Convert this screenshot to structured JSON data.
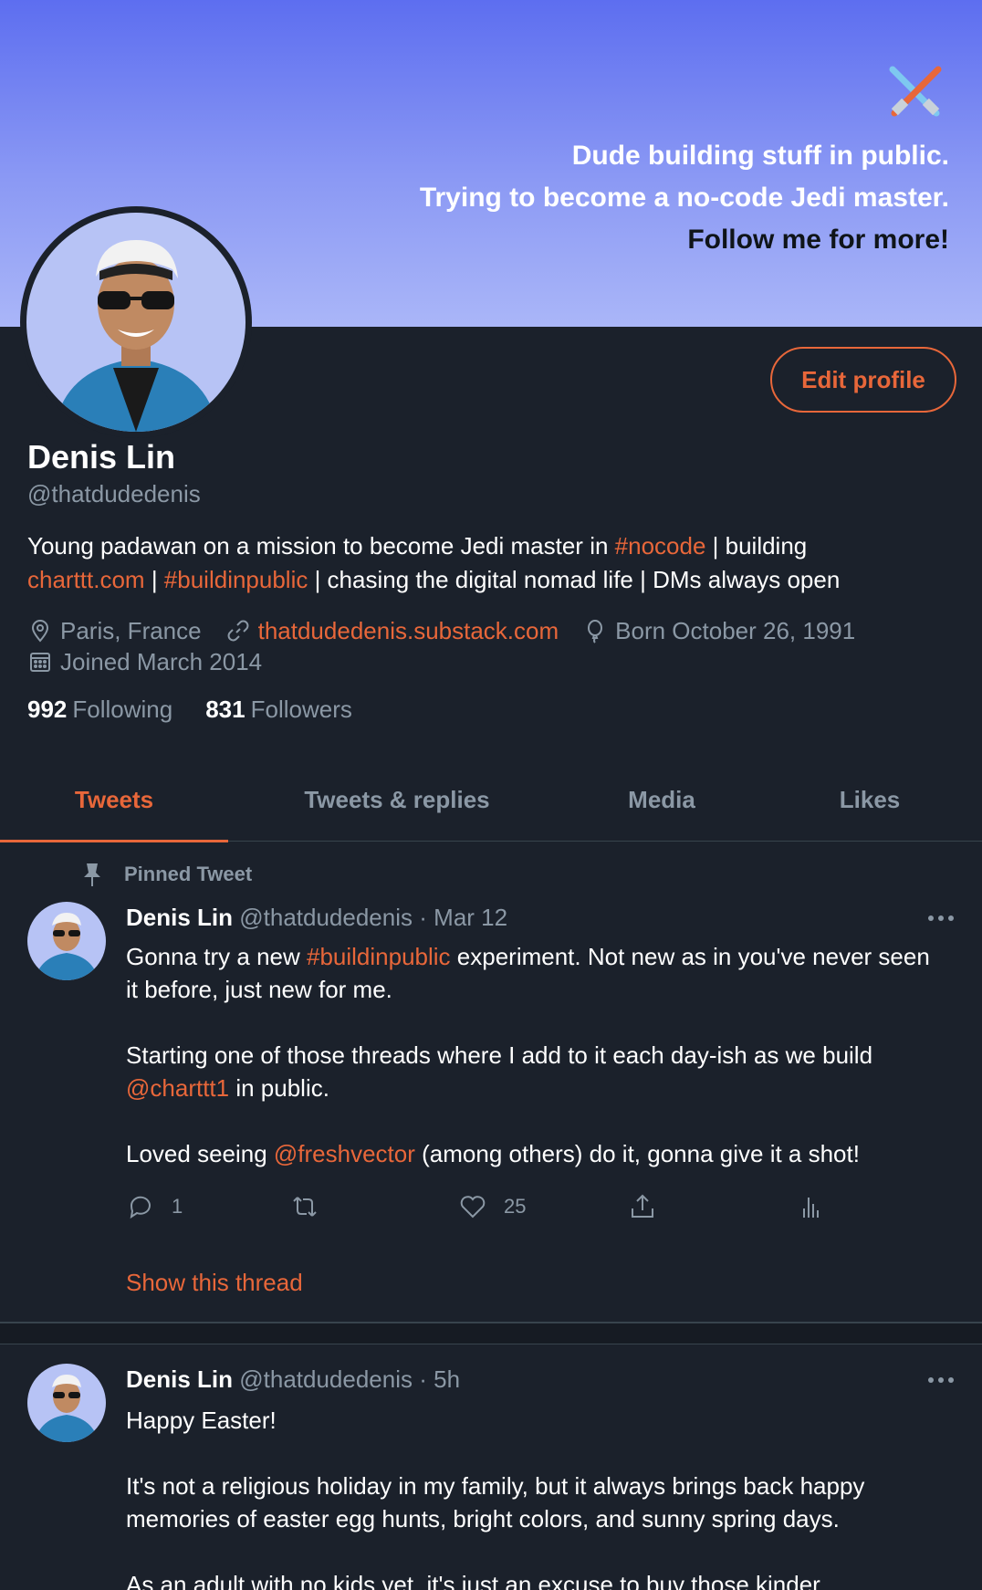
{
  "banner": {
    "line1": "Dude building stuff in public.",
    "line2": "Trying to become a no-code Jedi master.",
    "line3": "Follow me for more!",
    "icon": "crossed-lightsabers-icon"
  },
  "profile": {
    "name": "Denis Lin",
    "handle": "@thatdudedenis",
    "edit_label": "Edit profile",
    "bio": {
      "part1": "Young padawan on a mission to become Jedi master in ",
      "tag_nocode": "#nocode",
      "part2": " | building ",
      "link_charttt": "charttt.com",
      "part3": " | ",
      "tag_buildinpublic": "#buildinpublic",
      "part4": " | chasing the digital nomad life | DMs always open"
    },
    "location": "Paris, France",
    "website": "thatdudedenis.substack.com",
    "birthday": "Born October 26, 1991",
    "joined": "Joined March 2014",
    "following_count": "992",
    "following_label": "Following",
    "followers_count": "831",
    "followers_label": "Followers"
  },
  "tabs": [
    {
      "label": "Tweets",
      "active": true
    },
    {
      "label": "Tweets & replies",
      "active": false
    },
    {
      "label": "Media",
      "active": false
    },
    {
      "label": "Likes",
      "active": false
    }
  ],
  "pinned_tweet": {
    "pinned_label": "Pinned Tweet",
    "name": "Denis Lin",
    "handle": "@thatdudedenis",
    "sep": "·",
    "time": "Mar 12",
    "p1_a": "Gonna try a new ",
    "p1_tag": "#buildinpublic",
    "p1_b": " experiment. Not new as in you've never seen it before, just new for me.",
    "p2_a": "Starting one of those threads where I add to it each day-ish as we build ",
    "p2_mention": "@charttt1",
    "p2_b": " in public.",
    "p3_a": "Loved seeing ",
    "p3_mention": "@freshvector",
    "p3_b": " (among others) do it, gonna give it a shot!",
    "replies": "1",
    "likes": "25",
    "show_thread": "Show this thread"
  },
  "tweet2": {
    "name": "Denis Lin",
    "handle": "@thatdudedenis",
    "sep": "·",
    "time": "5h",
    "p1": "Happy Easter!",
    "p2": "It's not a religious holiday in my family, but it always brings back happy memories of easter egg hunts, bright colors, and sunny spring days.",
    "p3": "As an adult with no kids yet, it's just an excuse to buy those kinder"
  },
  "colors": {
    "accent": "#e8673a",
    "background": "#1b212b",
    "muted": "#8b98a5"
  }
}
